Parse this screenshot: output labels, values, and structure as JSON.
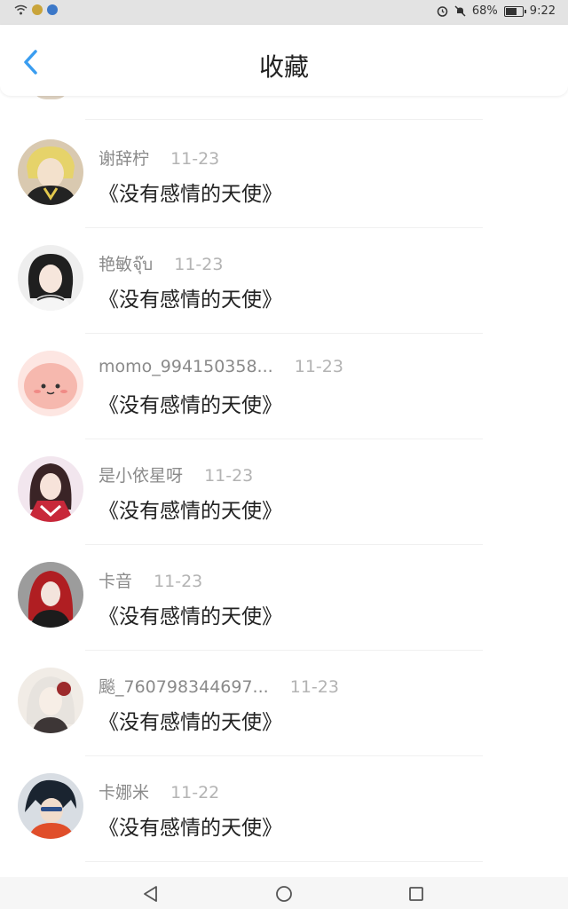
{
  "status_bar": {
    "battery_percent": "68%",
    "time": "9:22",
    "icons": [
      "wifi-icon",
      "app-notification-icon",
      "app-notification-icon-2",
      "alarm-icon",
      "mute-icon",
      "battery-icon"
    ]
  },
  "header": {
    "title": "收藏",
    "back_icon": "chevron-left-icon",
    "accent_color": "#3a9df0"
  },
  "items": [
    {
      "username": "谢辞柠",
      "date": "11-23",
      "title": "《没有感情的天使》"
    },
    {
      "username": "艳敏จุ๊บ",
      "date": "11-23",
      "title": "《没有感情的天使》"
    },
    {
      "username": "momo_994150358...",
      "date": "11-23",
      "title": "《没有感情的天使》"
    },
    {
      "username": "是小依星呀",
      "date": "11-23",
      "title": "《没有感情的天使》"
    },
    {
      "username": "卡音",
      "date": "11-23",
      "title": "《没有感情的天使》"
    },
    {
      "username": "飈_760798344697...",
      "date": "11-23",
      "title": "《没有感情的天使》"
    },
    {
      "username": "卡娜米",
      "date": "11-22",
      "title": "《没有感情的天使》"
    }
  ],
  "nav_bar": {
    "icons": [
      "back-triangle-icon",
      "home-circle-icon",
      "recents-square-icon"
    ]
  }
}
